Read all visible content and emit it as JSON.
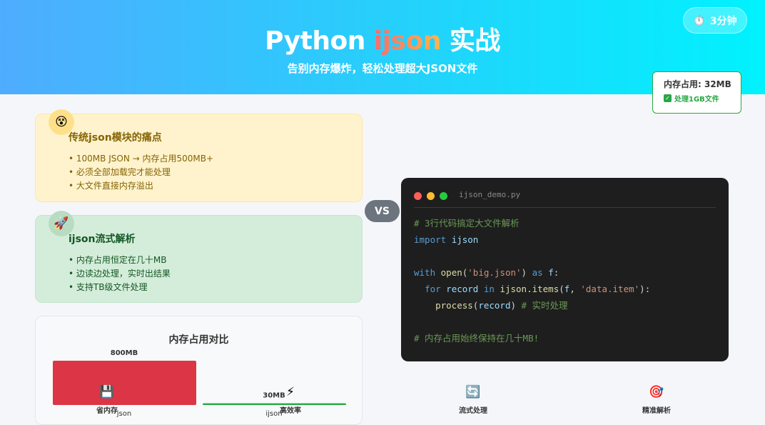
{
  "header": {
    "title_prefix": "Python ",
    "title_highlight": "ijson",
    "title_suffix": " 实战",
    "subtitle": "告别内存爆炸，轻松处理超大JSON文件",
    "timer_icon": "⏱️",
    "timer": "3分钟"
  },
  "memory_badge": {
    "label": "内存占用: 32MB",
    "status": "处理1GB文件",
    "status_icon": "✓"
  },
  "pain_card": {
    "icon": "😵",
    "title": "传统json模块的痛点",
    "items": [
      "100MB JSON → 内存占用500MB+",
      "必须全部加载完才能处理",
      "大文件直接内存溢出"
    ]
  },
  "good_card": {
    "icon": "🚀",
    "title": "ijson流式解析",
    "items": [
      "内存占用恒定在几十MB",
      "边读边处理，实时出结果",
      "支持TB级文件处理"
    ]
  },
  "vs_label": "VS",
  "chart_data": {
    "type": "bar",
    "title": "内存占用对比",
    "categories": [
      "json",
      "ijson"
    ],
    "values": [
      800,
      30
    ],
    "value_labels": [
      "800MB",
      "30MB"
    ],
    "unit": "MB",
    "colors": [
      "#dc3545",
      "#28a745"
    ],
    "ylim": [
      0,
      800
    ]
  },
  "code": {
    "filename": "ijson_demo.py",
    "comment1": "# 3行代码搞定大文件解析",
    "import_kw": "import",
    "import_mod": "ijson",
    "with_kw": "with",
    "open_fn": "open",
    "path": "'big.json'",
    "as_kw": "as",
    "f_var": "f",
    "for_kw": "for",
    "record_var": "record",
    "in_kw": "in",
    "items_call": "ijson.items",
    "prefix": "'data.item'",
    "process_fn": "process",
    "inline_comment": "# 实时处理",
    "comment2": "# 内存占用始终保持在几十MB!"
  },
  "features": [
    {
      "icon": "💾",
      "label": "省内存"
    },
    {
      "icon": "⚡",
      "label": "高效率"
    },
    {
      "icon": "🔄",
      "label": "流式处理"
    },
    {
      "icon": "🎯",
      "label": "精准解析"
    }
  ],
  "colors": {
    "header_start": "#4facfe",
    "header_end": "#00f2fe",
    "pain_bg": "#fff3cd",
    "good_bg": "#d4edda",
    "code_bg": "#1e1e1e",
    "dot_red": "#ff5f56",
    "dot_yellow": "#ffbd2e",
    "dot_green": "#27c93f"
  }
}
